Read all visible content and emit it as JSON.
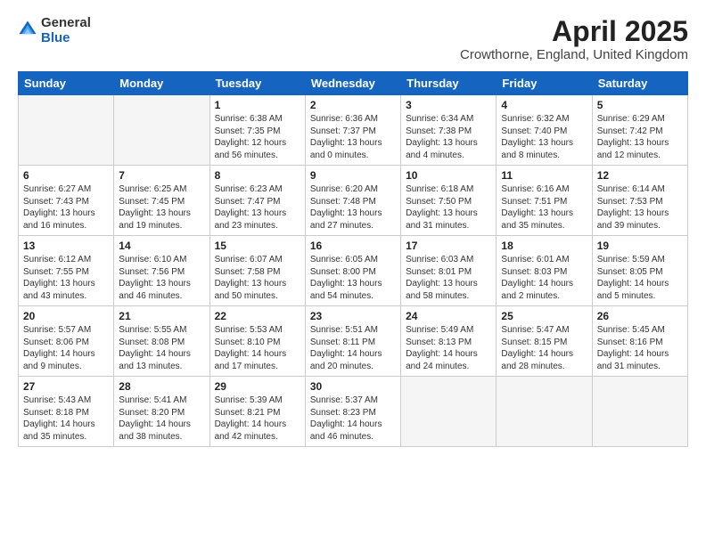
{
  "header": {
    "logo_general": "General",
    "logo_blue": "Blue",
    "title": "April 2025",
    "subtitle": "Crowthorne, England, United Kingdom"
  },
  "weekdays": [
    "Sunday",
    "Monday",
    "Tuesday",
    "Wednesday",
    "Thursday",
    "Friday",
    "Saturday"
  ],
  "weeks": [
    [
      {
        "day": "",
        "info": ""
      },
      {
        "day": "",
        "info": ""
      },
      {
        "day": "1",
        "info": "Sunrise: 6:38 AM\nSunset: 7:35 PM\nDaylight: 12 hours\nand 56 minutes."
      },
      {
        "day": "2",
        "info": "Sunrise: 6:36 AM\nSunset: 7:37 PM\nDaylight: 13 hours\nand 0 minutes."
      },
      {
        "day": "3",
        "info": "Sunrise: 6:34 AM\nSunset: 7:38 PM\nDaylight: 13 hours\nand 4 minutes."
      },
      {
        "day": "4",
        "info": "Sunrise: 6:32 AM\nSunset: 7:40 PM\nDaylight: 13 hours\nand 8 minutes."
      },
      {
        "day": "5",
        "info": "Sunrise: 6:29 AM\nSunset: 7:42 PM\nDaylight: 13 hours\nand 12 minutes."
      }
    ],
    [
      {
        "day": "6",
        "info": "Sunrise: 6:27 AM\nSunset: 7:43 PM\nDaylight: 13 hours\nand 16 minutes."
      },
      {
        "day": "7",
        "info": "Sunrise: 6:25 AM\nSunset: 7:45 PM\nDaylight: 13 hours\nand 19 minutes."
      },
      {
        "day": "8",
        "info": "Sunrise: 6:23 AM\nSunset: 7:47 PM\nDaylight: 13 hours\nand 23 minutes."
      },
      {
        "day": "9",
        "info": "Sunrise: 6:20 AM\nSunset: 7:48 PM\nDaylight: 13 hours\nand 27 minutes."
      },
      {
        "day": "10",
        "info": "Sunrise: 6:18 AM\nSunset: 7:50 PM\nDaylight: 13 hours\nand 31 minutes."
      },
      {
        "day": "11",
        "info": "Sunrise: 6:16 AM\nSunset: 7:51 PM\nDaylight: 13 hours\nand 35 minutes."
      },
      {
        "day": "12",
        "info": "Sunrise: 6:14 AM\nSunset: 7:53 PM\nDaylight: 13 hours\nand 39 minutes."
      }
    ],
    [
      {
        "day": "13",
        "info": "Sunrise: 6:12 AM\nSunset: 7:55 PM\nDaylight: 13 hours\nand 43 minutes."
      },
      {
        "day": "14",
        "info": "Sunrise: 6:10 AM\nSunset: 7:56 PM\nDaylight: 13 hours\nand 46 minutes."
      },
      {
        "day": "15",
        "info": "Sunrise: 6:07 AM\nSunset: 7:58 PM\nDaylight: 13 hours\nand 50 minutes."
      },
      {
        "day": "16",
        "info": "Sunrise: 6:05 AM\nSunset: 8:00 PM\nDaylight: 13 hours\nand 54 minutes."
      },
      {
        "day": "17",
        "info": "Sunrise: 6:03 AM\nSunset: 8:01 PM\nDaylight: 13 hours\nand 58 minutes."
      },
      {
        "day": "18",
        "info": "Sunrise: 6:01 AM\nSunset: 8:03 PM\nDaylight: 14 hours\nand 2 minutes."
      },
      {
        "day": "19",
        "info": "Sunrise: 5:59 AM\nSunset: 8:05 PM\nDaylight: 14 hours\nand 5 minutes."
      }
    ],
    [
      {
        "day": "20",
        "info": "Sunrise: 5:57 AM\nSunset: 8:06 PM\nDaylight: 14 hours\nand 9 minutes."
      },
      {
        "day": "21",
        "info": "Sunrise: 5:55 AM\nSunset: 8:08 PM\nDaylight: 14 hours\nand 13 minutes."
      },
      {
        "day": "22",
        "info": "Sunrise: 5:53 AM\nSunset: 8:10 PM\nDaylight: 14 hours\nand 17 minutes."
      },
      {
        "day": "23",
        "info": "Sunrise: 5:51 AM\nSunset: 8:11 PM\nDaylight: 14 hours\nand 20 minutes."
      },
      {
        "day": "24",
        "info": "Sunrise: 5:49 AM\nSunset: 8:13 PM\nDaylight: 14 hours\nand 24 minutes."
      },
      {
        "day": "25",
        "info": "Sunrise: 5:47 AM\nSunset: 8:15 PM\nDaylight: 14 hours\nand 28 minutes."
      },
      {
        "day": "26",
        "info": "Sunrise: 5:45 AM\nSunset: 8:16 PM\nDaylight: 14 hours\nand 31 minutes."
      }
    ],
    [
      {
        "day": "27",
        "info": "Sunrise: 5:43 AM\nSunset: 8:18 PM\nDaylight: 14 hours\nand 35 minutes."
      },
      {
        "day": "28",
        "info": "Sunrise: 5:41 AM\nSunset: 8:20 PM\nDaylight: 14 hours\nand 38 minutes."
      },
      {
        "day": "29",
        "info": "Sunrise: 5:39 AM\nSunset: 8:21 PM\nDaylight: 14 hours\nand 42 minutes."
      },
      {
        "day": "30",
        "info": "Sunrise: 5:37 AM\nSunset: 8:23 PM\nDaylight: 14 hours\nand 46 minutes."
      },
      {
        "day": "",
        "info": ""
      },
      {
        "day": "",
        "info": ""
      },
      {
        "day": "",
        "info": ""
      }
    ]
  ]
}
